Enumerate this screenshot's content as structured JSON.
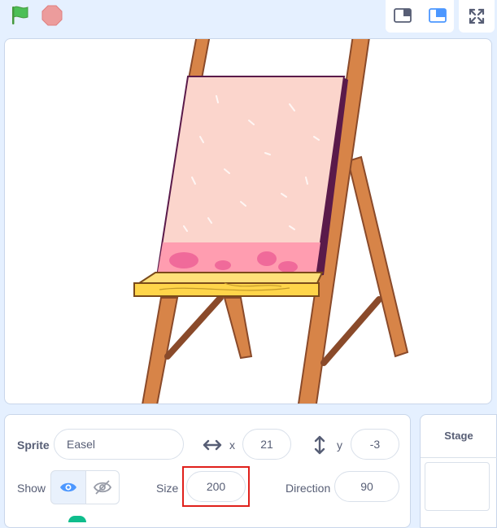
{
  "toolbar": {
    "green_flag_icon": "green-flag-icon",
    "stop_icon": "stop-icon",
    "small_stage_icon": "small-stage-icon",
    "large_stage_icon": "large-stage-icon",
    "fullscreen_icon": "fullscreen-icon"
  },
  "colors": {
    "accent": "#4c97ff",
    "highlight_border": "#e0201b",
    "green_flag": "#4cbf56",
    "stop": "#ec9c9c",
    "easel_wood": "#d78448",
    "canvas_pink": "#fbd5cc",
    "paint_pink": "#ff9db0",
    "shelf_yellow": "#ffd54a"
  },
  "sprite_info": {
    "sprite_label": "Sprite",
    "sprite_name": "Easel",
    "x_label": "x",
    "x_value": "21",
    "y_label": "y",
    "y_value": "-3",
    "show_label": "Show",
    "size_label": "Size",
    "size_value": "200",
    "direction_label": "Direction",
    "direction_value": "90"
  },
  "stage_panel": {
    "title": "Stage"
  }
}
